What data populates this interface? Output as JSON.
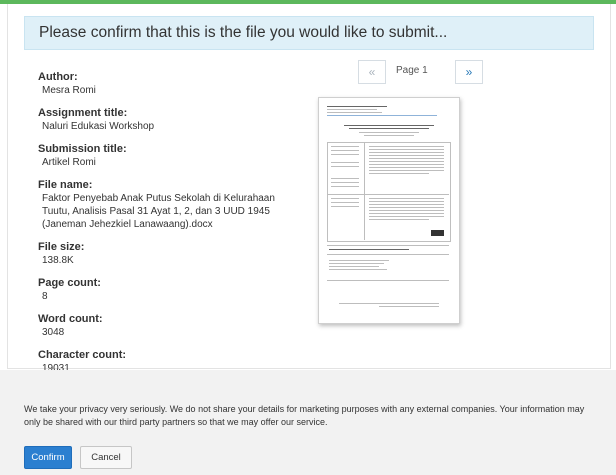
{
  "header": {
    "title": "Please confirm that this is the file you would like to submit..."
  },
  "fields": [
    {
      "label": "Author:",
      "value": "Mesra Romi"
    },
    {
      "label": "Assignment title:",
      "value": "Naluri Edukasi Workshop"
    },
    {
      "label": "Submission title:",
      "value": "Artikel Romi"
    },
    {
      "label": "File name:",
      "value": "Faktor Penyebab Anak Putus Sekolah di Kelurahaan Tuutu, Analisis Pasal 31 Ayat 1, 2, dan 3 UUD 1945 (Janeman Jehezkiel Lanawaang).docx"
    },
    {
      "label": "File size:",
      "value": "138.8K"
    },
    {
      "label": "Page count:",
      "value": "8"
    },
    {
      "label": "Word count:",
      "value": "3048"
    },
    {
      "label": "Character count:",
      "value": "19031"
    }
  ],
  "pager": {
    "prev": "«",
    "page_label": "Page 1",
    "next": "»"
  },
  "preview": {
    "icon": "document-thumbnail"
  },
  "footer": {
    "privacy": "We take your privacy very seriously. We do not share your details for marketing purposes with any external companies. Your information may only be shared with our third party partners so that we may offer our service.",
    "confirm_label": "Confirm",
    "cancel_label": "Cancel"
  },
  "colors": {
    "accent": "#2b7fd0",
    "header_bg": "#dff0f8",
    "frame_green": "#5cb85c"
  }
}
